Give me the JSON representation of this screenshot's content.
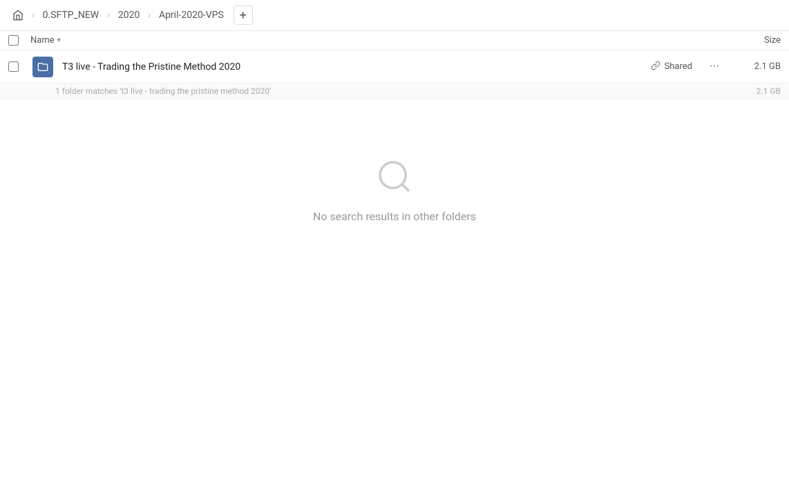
{
  "breadcrumb": {
    "home_label": "home",
    "items": [
      {
        "label": "0.SFTP_NEW"
      },
      {
        "label": "2020"
      },
      {
        "label": "April-2020-VPS"
      }
    ],
    "add_label": "+"
  },
  "column_header": {
    "name_label": "Name",
    "name_chevron": "▾",
    "size_label": "Size"
  },
  "file_row": {
    "name": "T3 live - Trading the Pristine Method 2020",
    "shared_label": "Shared",
    "more_label": "···",
    "size": "2.1 GB"
  },
  "match_info": {
    "text": "1 folder matches 't3 live - trading the pristine method 2020'",
    "size": "2.1 GB"
  },
  "no_results": {
    "text": "No search results in other folders"
  }
}
